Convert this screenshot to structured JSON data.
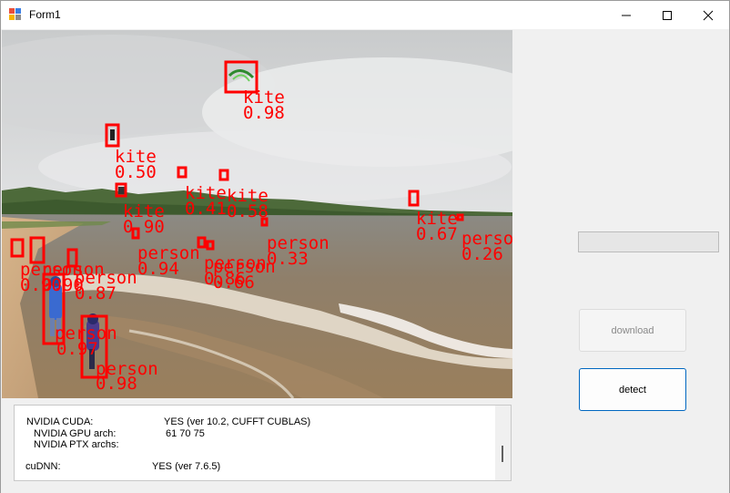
{
  "window": {
    "title": "Form1",
    "minimize_icon": "minimize-icon",
    "maximize_icon": "maximize-icon",
    "close_icon": "close-icon"
  },
  "detections": [
    {
      "class": "kite",
      "score": "0.98",
      "color": "#ff0000"
    },
    {
      "class": "kite",
      "score": "0.50",
      "color": "#ff0000"
    },
    {
      "class": "kite",
      "score": "0.90",
      "color": "#ff0000"
    },
    {
      "class": "kite",
      "score": "0.41",
      "color": "#ff0000"
    },
    {
      "class": "kite",
      "score": "0.58",
      "color": "#ff0000"
    },
    {
      "class": "kite",
      "score": "0.67",
      "color": "#ff0000"
    },
    {
      "class": "person",
      "score": "0.26",
      "color": "#ff0000"
    },
    {
      "class": "person",
      "score": "0.33",
      "color": "#ff0000"
    },
    {
      "class": "person",
      "score": "0.94",
      "color": "#ff0000"
    },
    {
      "class": "person",
      "score": "0.86",
      "color": "#ff0000"
    },
    {
      "class": "person",
      "score": "0.66",
      "color": "#ff0000"
    },
    {
      "class": "person",
      "score": "0.87",
      "color": "#ff0000"
    },
    {
      "class": "person",
      "score": "0.90",
      "color": "#ff0000"
    },
    {
      "class": "person",
      "score": "0.90",
      "color": "#ff0000"
    },
    {
      "class": "person",
      "score": "0.97",
      "color": "#ff0000"
    },
    {
      "class": "person",
      "score": "0.98",
      "color": "#ff0000"
    }
  ],
  "output": {
    "lines": [
      {
        "label": "NVIDIA CUDA:",
        "value": "YES (ver 10.2, CUFFT CUBLAS)"
      },
      {
        "label": "NVIDIA GPU arch:",
        "value": "61 70 75"
      },
      {
        "label": "NVIDIA PTX archs:",
        "value": ""
      },
      {
        "label": "cuDNN:",
        "value": "YES (ver 7.6.5)"
      }
    ]
  },
  "progress": {
    "value": 0
  },
  "buttons": {
    "download_label": "download",
    "download_enabled": false,
    "detect_label": "detect"
  },
  "colors": {
    "box": "#ff0000",
    "detect_border": "#0067c0",
    "window_bg": "#f0f0f0"
  }
}
